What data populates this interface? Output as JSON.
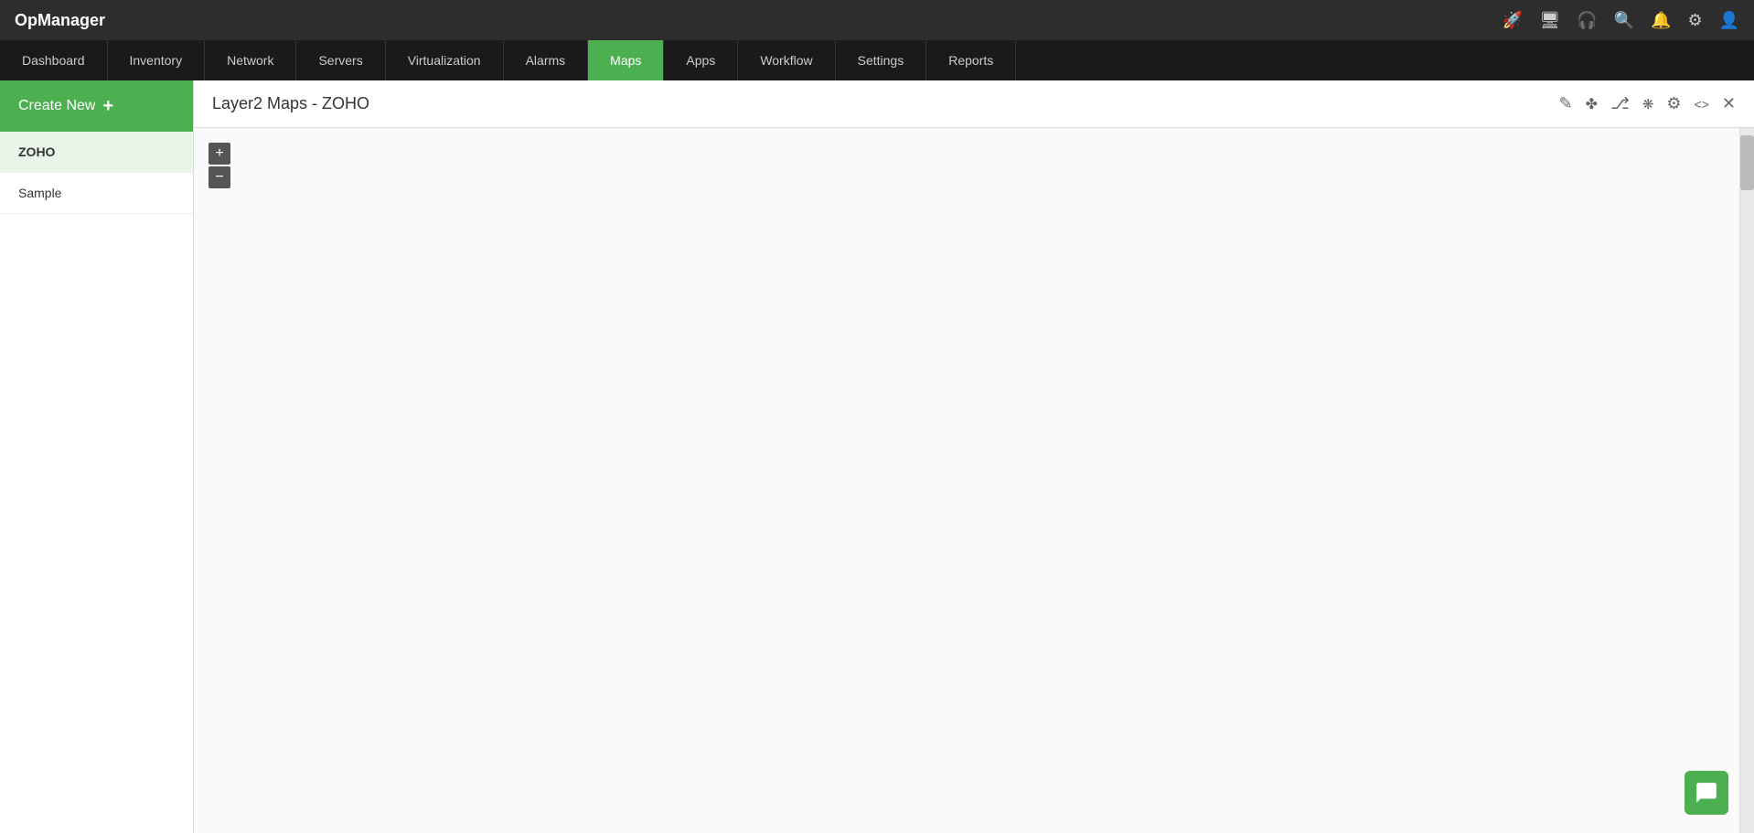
{
  "app": {
    "name": "OpManager"
  },
  "topbar": {
    "icons": [
      "rocket-icon",
      "monitor-icon",
      "bell-outline-icon",
      "search-icon",
      "bell-icon",
      "settings-icon",
      "user-icon"
    ]
  },
  "navbar": {
    "items": [
      {
        "label": "Dashboard",
        "active": false
      },
      {
        "label": "Inventory",
        "active": false
      },
      {
        "label": "Network",
        "active": false
      },
      {
        "label": "Servers",
        "active": false
      },
      {
        "label": "Virtualization",
        "active": false
      },
      {
        "label": "Alarms",
        "active": false
      },
      {
        "label": "Maps",
        "active": true
      },
      {
        "label": "Apps",
        "active": false
      },
      {
        "label": "Workflow",
        "active": false
      },
      {
        "label": "Settings",
        "active": false
      },
      {
        "label": "Reports",
        "active": false
      }
    ]
  },
  "sidebar": {
    "create_new_label": "Create New",
    "plus_icon": "+",
    "items": [
      {
        "label": "ZOHO",
        "active": true
      },
      {
        "label": "Sample",
        "active": false
      }
    ]
  },
  "content": {
    "title": "Layer2 Maps - ZOHO",
    "header_icons": [
      "edit-icon",
      "refresh-icon",
      "share-icon",
      "nodes-icon",
      "gear-icon",
      "code-icon",
      "close-icon"
    ],
    "zoom_in_label": "+",
    "zoom_out_label": "−"
  },
  "chat_button": {
    "label": "chat"
  }
}
